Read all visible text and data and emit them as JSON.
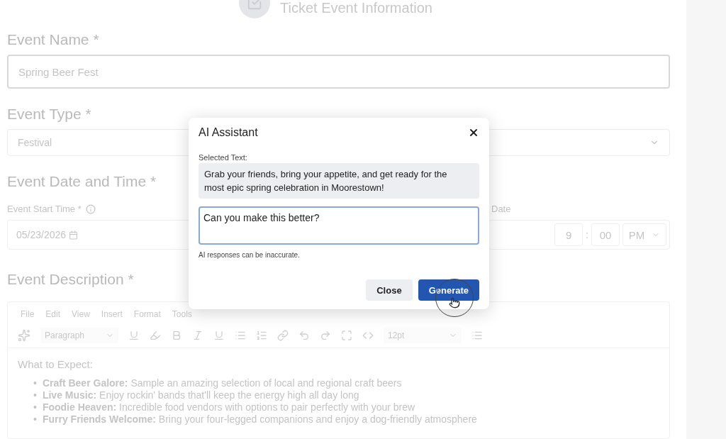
{
  "page": {
    "title": "Ticket Event Information"
  },
  "fields": [
    {
      "kind": "text",
      "label": "Event Name *",
      "value": "Spring Beer Fest"
    },
    {
      "kind": "select",
      "label": "Event Type *",
      "value": "Festival"
    }
  ],
  "date_time": {
    "label": "Event Date and Time *",
    "start_label": "Event Start Time *",
    "start_date": "05/23/2026",
    "end_label": "Date",
    "hour": "9",
    "separator": ":",
    "minute": "00",
    "period": "PM"
  },
  "description": {
    "label": "Event Description *",
    "menu": [
      "File",
      "Edit",
      "View",
      "Insert",
      "Format",
      "Tools"
    ],
    "block_format": "Paragraph",
    "font_size": "12pt",
    "heading": "What to Expect:",
    "items": [
      {
        "marker": "•",
        "text": "**Craft Beer Galore:** Sample an amazing selection of local and regional craft beers"
      },
      {
        "marker": "•",
        "text": "**Live Music:** Enjoy rockin' bands that'll keep the energy high all day long"
      },
      {
        "marker": "•",
        "text": "**Foodie Heaven:** Incredible food vendors with options to pair perfectly with your brew"
      },
      {
        "marker": "•",
        "text": "**Furry Friends Welcome:** Bring your four-legged companions and enjoy a dog-friendly atmosphere"
      }
    ]
  },
  "dialog": {
    "title": "AI Assistant",
    "selected_label": "Selected Text:",
    "selected_text": "Grab your friends, bring your appetite, and get ready for the most epic spring celebration in Moorestown!",
    "prompt": "Can you make this better?",
    "note": "AI responses can be inaccurate.",
    "buttons": [
      {
        "label": "Close",
        "kind": "secondary"
      },
      {
        "label": "Generate",
        "kind": "primary"
      }
    ]
  }
}
